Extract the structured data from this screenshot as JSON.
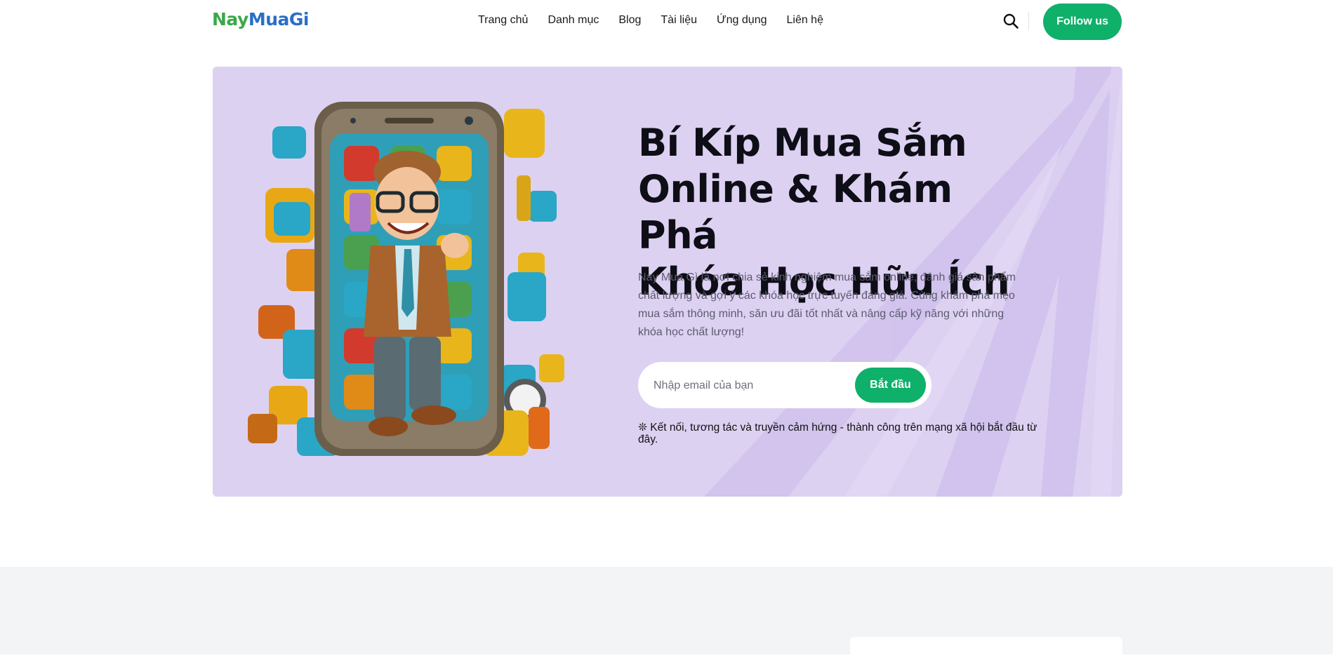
{
  "header": {
    "logo": {
      "part1": "Nay",
      "part2": "MuaGi"
    },
    "nav": [
      "Trang chủ",
      "Danh mục",
      "Blog",
      "Tài liệu",
      "Ứng dụng",
      "Liên hệ"
    ],
    "search_icon": "search-icon",
    "follow_label": "Follow us"
  },
  "hero": {
    "title_lines": [
      "Bí Kíp Mua Sắm",
      "Online & Khám Phá",
      "Khóa Học Hữu Ích"
    ],
    "description": "Nay Mua Gì là nơi chia sẻ kinh nghiệm mua sắm online, đánh giá sản phẩm chất lượng và gợi ý các khóa học trực tuyến đáng giá. Cùng khám phá mẹo mua sắm thông minh, săn ưu đãi tốt nhất và nâng cấp kỹ năng với những khóa học chất lượng!",
    "email_placeholder": "Nhập email của bạn",
    "start_label": "Bắt đầu",
    "note": "❊ Kết nối, tương tác và truyền cảm hứng - thành công trên mạng xã hội bắt đầu từ đây."
  },
  "colors": {
    "accent_green": "#0fb06a",
    "hero_bg": "#ddd1f2",
    "logo_green": "#3aa84a",
    "logo_blue": "#2a6fc9"
  }
}
